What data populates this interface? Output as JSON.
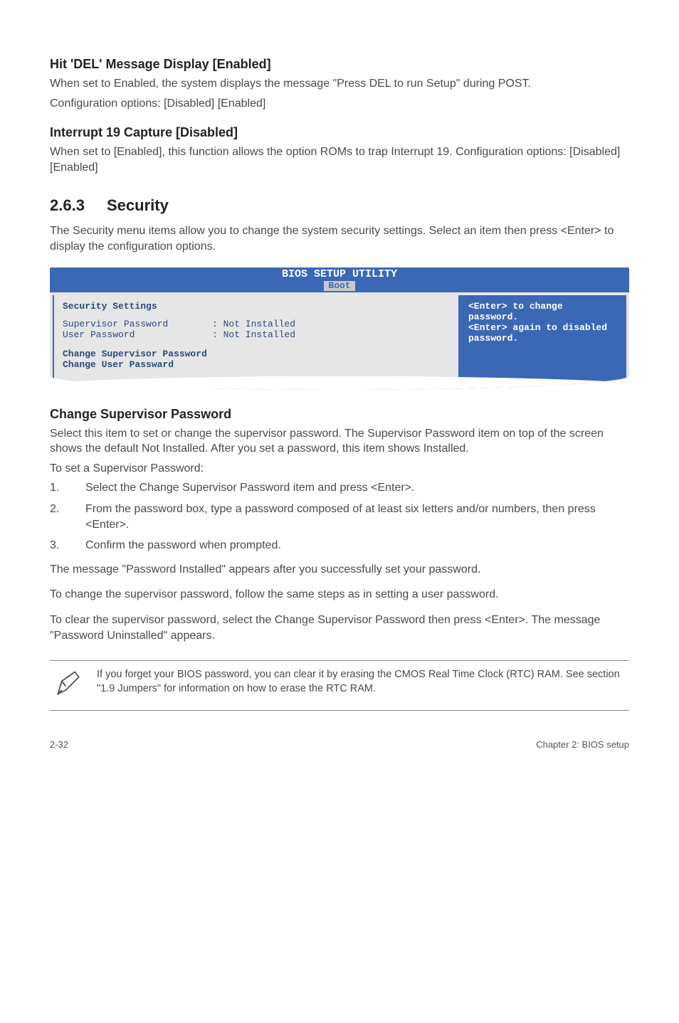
{
  "sections": {
    "s1": {
      "title": "Hit 'DEL' Message Display [Enabled]",
      "p1": "When set to Enabled, the system displays the message \"Press DEL to run Setup\" during POST.",
      "p2": "Configuration options: [Disabled] [Enabled]"
    },
    "s2": {
      "title": "Interrupt 19 Capture [Disabled]",
      "p1": "When set to [Enabled], this function allows the option ROMs to trap Interrupt 19. Configuration options: [Disabled] [Enabled]"
    },
    "sec263": {
      "num": "2.6.3",
      "title": "Security",
      "intro": "The Security menu items allow you to change the system security settings. Select an item then press <Enter> to display the configuration options."
    },
    "csp": {
      "title": "Change Supervisor Password",
      "p1": "Select this item to set or change the supervisor password. The Supervisor Password item on top of the screen shows the default Not Installed. After you set a password, this item shows Installed.",
      "p2": "To set a Supervisor Password:",
      "steps": [
        "Select the Change Supervisor Password item and press <Enter>.",
        "From the password box, type a password composed of at least six letters and/or numbers, then press <Enter>.",
        "Confirm the password when prompted."
      ],
      "p3": "The message \"Password Installed\" appears after you successfully set your password.",
      "p4": "To change the supervisor password, follow the same steps as in setting a user password.",
      "p5": "To clear the supervisor password, select the Change Supervisor Password then press <Enter>. The message \"Password Uninstalled\" appears."
    },
    "note": "If you forget your BIOS password, you can clear it by erasing the CMOS Real Time Clock (RTC) RAM. See section \"1.9 Jumpers\" for information on how to erase the RTC RAM."
  },
  "bios": {
    "header_title": "BIOS SETUP UTILITY",
    "header_tab": "Boot",
    "left": {
      "title": "Security Settings",
      "row1_label": "Supervisor Password",
      "row1_value": ": Not Installed",
      "row2_label": "User Password",
      "row2_value": ": Not Installed",
      "opt1": "Change Supervisor Password",
      "opt2": "Change User Passward"
    },
    "right": "<Enter> to change password.\n<Enter> again to disabled password."
  },
  "footer": {
    "left": "2-32",
    "right": "Chapter 2: BIOS setup"
  }
}
